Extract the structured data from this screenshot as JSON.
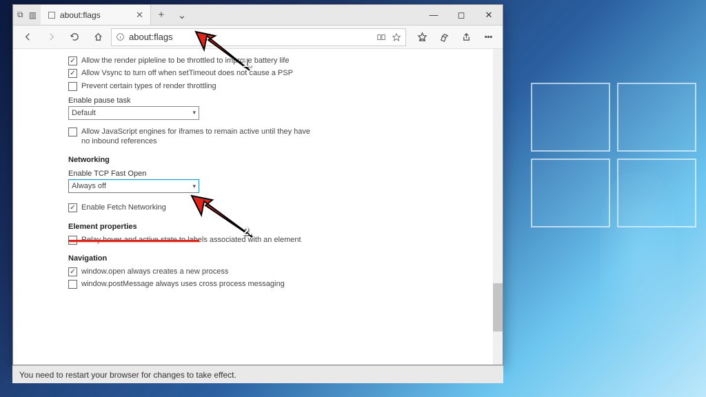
{
  "tab": {
    "title": "about:flags"
  },
  "addressbar": {
    "url": "about:flags"
  },
  "flags": {
    "render_pipeline": {
      "label": "Allow the render pipleline to be throttled to improve battery life",
      "checked": true
    },
    "vsync": {
      "label": "Allow Vsync to turn off when setTimeout does not cause a PSP",
      "checked": true
    },
    "throttling": {
      "label": "Prevent certain types of render throttling",
      "checked": false
    },
    "pause_task": {
      "label": "Enable pause task",
      "value": "Default"
    },
    "js_iframes": {
      "label": "Allow JavaScript engines for iframes to remain active until they have no inbound references",
      "checked": false
    }
  },
  "networking": {
    "heading": "Networking",
    "tcp_fast_open": {
      "label": "Enable TCP Fast Open",
      "value": "Always off"
    },
    "fetch": {
      "label": "Enable Fetch Networking",
      "checked": true
    }
  },
  "element_props": {
    "heading": "Element properties",
    "relay": {
      "label": "Relay hover and active state to labels associated with an element",
      "checked": false
    }
  },
  "navigation": {
    "heading": "Navigation",
    "window_open": {
      "label": "window.open always creates a new process",
      "checked": true
    },
    "post_message": {
      "label": "window.postMessage always uses cross process messaging",
      "checked": false
    }
  },
  "status_bar": "You need to restart your browser for changes to take effect.",
  "annotations": {
    "step1": "1.",
    "step2": "2."
  }
}
